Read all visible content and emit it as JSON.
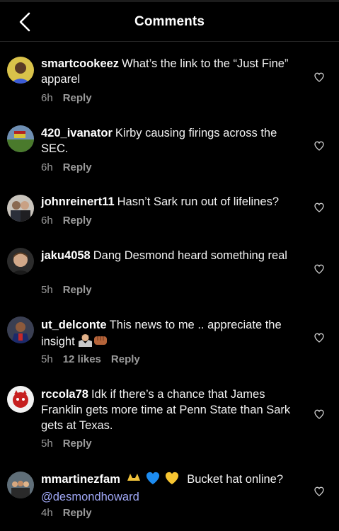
{
  "header": {
    "title": "Comments",
    "back_icon": "chevron-left-icon"
  },
  "comments": [
    {
      "username": "smartcookeez",
      "text": "What’s the link to the “Just Fine” apparel",
      "time": "6h",
      "reply_label": "Reply",
      "likes": ""
    },
    {
      "username": "420_ivanator",
      "text": "Kirby causing firings across the SEC.",
      "time": "6h",
      "reply_label": "Reply",
      "likes": ""
    },
    {
      "username": "johnreinert11",
      "text": "Hasn’t Sark run out of lifelines?",
      "time": "6h",
      "reply_label": "Reply",
      "likes": ""
    },
    {
      "username": "jaku4058",
      "text": "Dang Desmond heard something real",
      "time": "5h",
      "reply_label": "Reply",
      "likes": ""
    },
    {
      "username": "ut_delconte",
      "text": "This news to me .. appreciate the insight",
      "emojis": [
        "person-shrugging-emoji",
        "fist-bump-emoji"
      ],
      "time": "5h",
      "reply_label": "Reply",
      "likes": "12 likes"
    },
    {
      "username": "rccola78",
      "text": "Idk if there’s a chance that James Franklin gets more time at Penn State than Sark gets at Texas.",
      "time": "5h",
      "reply_label": "Reply",
      "likes": ""
    },
    {
      "username": "mmartinezfam",
      "text": "Bucket hat online?",
      "emojis": [
        "hook-em-hand-emoji",
        "blue-heart-emoji",
        "yellow-heart-emoji"
      ],
      "mention": "@desmondhoward",
      "time": "4h",
      "reply_label": "Reply",
      "likes": ""
    }
  ],
  "colors": {
    "background": "#000000",
    "mention": "#a0a8f6",
    "meta": "#9a9a9a"
  }
}
